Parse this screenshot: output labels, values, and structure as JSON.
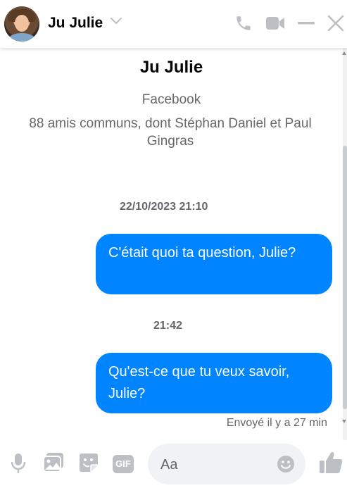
{
  "header": {
    "contact_name": "Ju Julie",
    "icons": [
      "chevron-down-icon",
      "phone-icon",
      "video-camera-icon",
      "minimize-icon",
      "close-icon"
    ],
    "accent_color": "#bcc0c4"
  },
  "thread": {
    "profile": {
      "name": "Ju Julie",
      "subtitle": "Facebook",
      "mutual_friends": "88 amis communs, dont Stéphan Daniel et Paul Gingras"
    },
    "messages": [
      {
        "timestamp": "22/10/2023 21:10",
        "text": "C'était quoi ta question, Julie?"
      },
      {
        "timestamp": "21:42",
        "text": "Qu'est-ce que tu veux savoir, Julie?"
      }
    ],
    "status": "Envoyé il y a 27 min",
    "bubble_color": "#0084ff"
  },
  "composer": {
    "placeholder": "Aa",
    "icons": [
      "microphone-icon",
      "photo-icon",
      "sticker-icon",
      "gif-icon",
      "emoji-icon",
      "thumbs-up-icon"
    ],
    "gif_label": "GIF",
    "accent_color": "#0084ff"
  }
}
